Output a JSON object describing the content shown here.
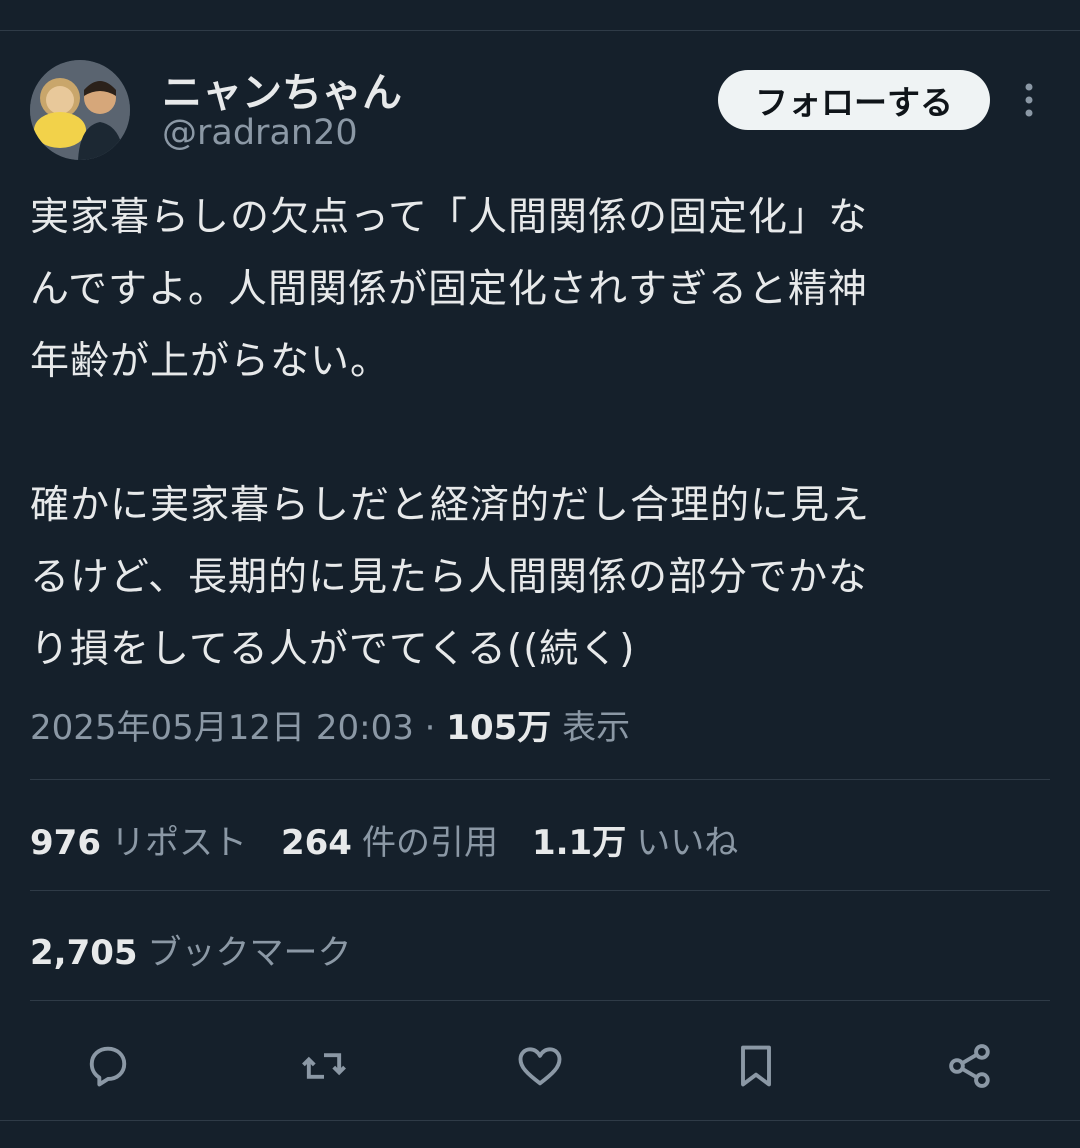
{
  "author": {
    "display_name": "ニャンちゃん",
    "handle": "@radran20",
    "avatar_icon": "profile-photo"
  },
  "follow_label": "フォローする",
  "tweet": {
    "paragraph1": "実家暮らしの欠点って「人間関係の固定化」な\nんですよ。人間関係が固定化されすぎると精神\n年齢が上がらない。",
    "paragraph2": "確かに実家暮らしだと経済的だし合理的に見え\nるけど、長期的に見たら人間関係の部分でかな\nり損をしてる人がでてくる((続く)"
  },
  "meta": {
    "datetime": "2025年05月12日 20:03",
    "separator": "·",
    "views": "105万",
    "views_label": "表示"
  },
  "stats": {
    "reposts": "976",
    "reposts_label": "リポスト",
    "quotes": "264",
    "quotes_label": "件の引用",
    "likes": "1.1万",
    "likes_label": "いいね",
    "bookmarks": "2,705",
    "bookmarks_label": "ブックマーク"
  },
  "colors": {
    "background": "#15202b",
    "text_primary": "#e7e9ea",
    "text_secondary": "#8b98a5",
    "divider": "#2f3b47",
    "button_bg": "#eff3f4"
  },
  "actions": [
    "reply-icon",
    "repost-icon",
    "like-icon",
    "bookmark-icon",
    "share-icon"
  ]
}
